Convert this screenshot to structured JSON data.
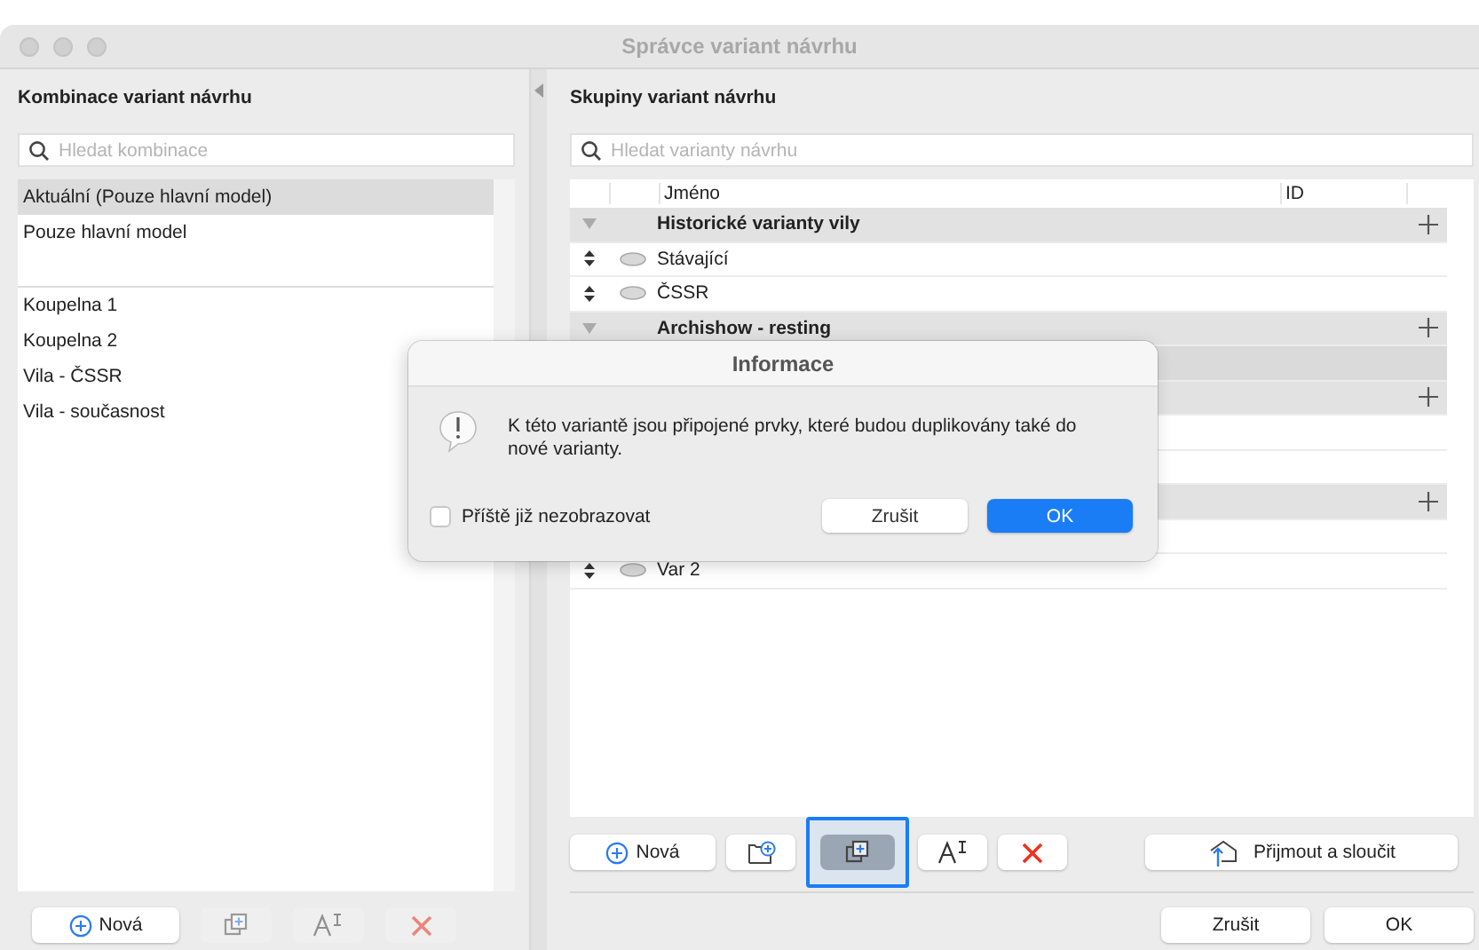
{
  "window": {
    "title": "Správce variant návrhu"
  },
  "combinations": {
    "title": "Kombinace variant návrhu",
    "search": {
      "placeholder": "Hledat kombinace"
    },
    "main_items": [
      {
        "label": "Aktuální (Pouze hlavní model)",
        "selected": true
      },
      {
        "label": "Pouze hlavní model",
        "selected": false
      }
    ],
    "variant_items": [
      {
        "label": "Koupelna 1",
        "selected": false
      },
      {
        "label": "Koupelna 2",
        "selected": false
      },
      {
        "label": "Vila - ČSSR",
        "selected": false
      },
      {
        "label": "Vila - současnost",
        "selected": false
      }
    ],
    "toolbar": [
      {
        "kind": "new",
        "label": "Nová",
        "disabled": false
      },
      {
        "kind": "duplicate",
        "disabled": true
      },
      {
        "kind": "rename",
        "disabled": true
      },
      {
        "kind": "delete",
        "disabled": true
      }
    ]
  },
  "groups": {
    "title": "Skupiny variant návrhu",
    "search": {
      "placeholder": "Hledat varianty návrhu"
    },
    "columns": [
      "Jméno",
      "ID"
    ],
    "rows": [
      {
        "kind": "group",
        "name": "Historické varianty vily"
      },
      {
        "kind": "item",
        "name": "Stávající",
        "selected": false
      },
      {
        "kind": "item",
        "name": "ČSSR",
        "selected": false
      },
      {
        "kind": "group",
        "name": "Archishow - resting"
      },
      {
        "kind": "item",
        "selected": true
      },
      {
        "kind": "group"
      },
      {
        "kind": "item",
        "selected": false
      },
      {
        "kind": "item",
        "selected": false
      },
      {
        "kind": "group"
      },
      {
        "kind": "item",
        "selected": false
      },
      {
        "kind": "item",
        "name": "Var 2",
        "selected": false
      }
    ],
    "toolbar": [
      {
        "kind": "new",
        "label": "Nová",
        "focused": false
      },
      {
        "kind": "add-folder",
        "focused": false
      },
      {
        "kind": "duplicate",
        "focused": true
      },
      {
        "kind": "rename",
        "focused": false
      },
      {
        "kind": "delete",
        "focused": false
      },
      {
        "kind": "accept",
        "label": "Přijmout a sloučit",
        "focused": false
      }
    ]
  },
  "buttons": [
    "Zrušit",
    "OK"
  ],
  "dialog": {
    "title": "Informace",
    "message": "K této variantě jsou připojené prvky, které budou duplikovány také do nové varianty.",
    "checkbox": {
      "label": "Příště již nezobrazovat",
      "checked": false
    },
    "buttons": [
      {
        "label": "Zrušit",
        "default": false
      },
      {
        "label": "OK",
        "default": true
      }
    ]
  }
}
